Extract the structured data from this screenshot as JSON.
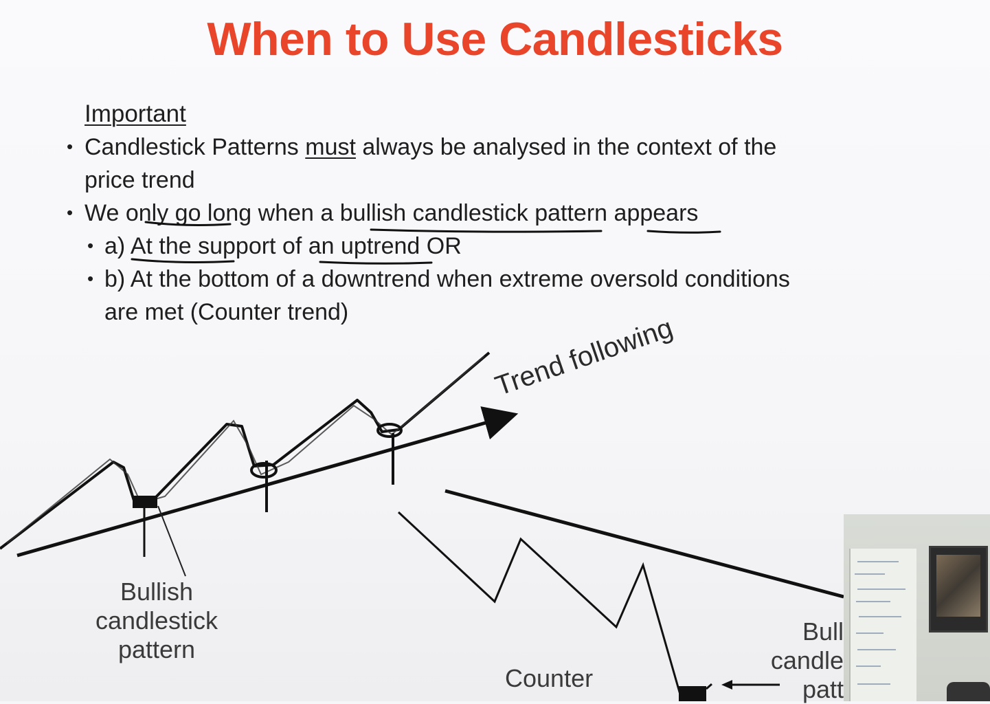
{
  "slide": {
    "title": "When to Use Candlesticks",
    "heading": "Important",
    "bullet1": {
      "pre": "Candlestick Patterns ",
      "emph": "must",
      "post": " always be analysed in the context of the",
      "line2": "price trend"
    },
    "bullet2": {
      "pre": "We ",
      "emph1": "only go l",
      "mid": "ong when a ",
      "emph2": "bullish candlestick pattern",
      "mid2": " ",
      "emph3": "appears"
    },
    "sub_a": {
      "prefix": "a) ",
      "emph": "At the support of an uptrend",
      "post": " OR"
    },
    "sub_b": {
      "line1": "b) At the bottom of a downtrend when extreme oversold conditions",
      "line2": "are met (Counter trend)"
    }
  },
  "diagram": {
    "trend_label": "Trend following",
    "bullish_label": [
      "Bullish",
      "candlestick",
      "pattern"
    ],
    "counter_label": "Counter",
    "bull_label_cut": [
      "Bull",
      "candle",
      "patt"
    ]
  },
  "colors": {
    "title": "#e8452a",
    "text": "#1e1e1e",
    "ink": "#111111"
  },
  "icons": [
    "arrow-right-icon",
    "arrow-left-icon"
  ]
}
